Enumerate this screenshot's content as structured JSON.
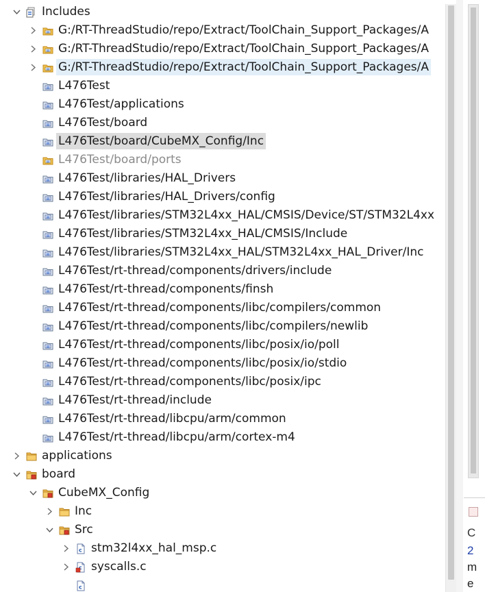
{
  "tree": [
    {
      "label": "Includes",
      "depth": 0,
      "expander": "expanded",
      "icon": "includes-icon"
    },
    {
      "label": "G:/RT-ThreadStudio/repo/Extract/ToolChain_Support_Packages/A",
      "depth": 1,
      "expander": "collapsed",
      "icon": "include-folder-icon"
    },
    {
      "label": "G:/RT-ThreadStudio/repo/Extract/ToolChain_Support_Packages/A",
      "depth": 1,
      "expander": "collapsed",
      "icon": "include-folder-icon"
    },
    {
      "label": "G:/RT-ThreadStudio/repo/Extract/ToolChain_Support_Packages/A",
      "depth": 1,
      "expander": "collapsed",
      "icon": "include-folder-icon",
      "state": "hover"
    },
    {
      "label": "L476Test",
      "depth": 1,
      "expander": "none",
      "icon": "include-path-icon"
    },
    {
      "label": "L476Test/applications",
      "depth": 1,
      "expander": "none",
      "icon": "include-path-icon"
    },
    {
      "label": "L476Test/board",
      "depth": 1,
      "expander": "none",
      "icon": "include-path-icon"
    },
    {
      "label": "L476Test/board/CubeMX_Config/Inc",
      "depth": 1,
      "expander": "none",
      "icon": "include-path-icon",
      "state": "selected"
    },
    {
      "label": "L476Test/board/ports",
      "depth": 1,
      "expander": "none",
      "icon": "include-folder-icon",
      "state": "disabled"
    },
    {
      "label": "L476Test/libraries/HAL_Drivers",
      "depth": 1,
      "expander": "none",
      "icon": "include-path-icon"
    },
    {
      "label": "L476Test/libraries/HAL_Drivers/config",
      "depth": 1,
      "expander": "none",
      "icon": "include-path-icon"
    },
    {
      "label": "L476Test/libraries/STM32L4xx_HAL/CMSIS/Device/ST/STM32L4xx",
      "depth": 1,
      "expander": "none",
      "icon": "include-path-icon"
    },
    {
      "label": "L476Test/libraries/STM32L4xx_HAL/CMSIS/Include",
      "depth": 1,
      "expander": "none",
      "icon": "include-path-icon"
    },
    {
      "label": "L476Test/libraries/STM32L4xx_HAL/STM32L4xx_HAL_Driver/Inc",
      "depth": 1,
      "expander": "none",
      "icon": "include-path-icon"
    },
    {
      "label": "L476Test/rt-thread/components/drivers/include",
      "depth": 1,
      "expander": "none",
      "icon": "include-path-icon"
    },
    {
      "label": "L476Test/rt-thread/components/finsh",
      "depth": 1,
      "expander": "none",
      "icon": "include-path-icon"
    },
    {
      "label": "L476Test/rt-thread/components/libc/compilers/common",
      "depth": 1,
      "expander": "none",
      "icon": "include-path-icon"
    },
    {
      "label": "L476Test/rt-thread/components/libc/compilers/newlib",
      "depth": 1,
      "expander": "none",
      "icon": "include-path-icon"
    },
    {
      "label": "L476Test/rt-thread/components/libc/posix/io/poll",
      "depth": 1,
      "expander": "none",
      "icon": "include-path-icon"
    },
    {
      "label": "L476Test/rt-thread/components/libc/posix/io/stdio",
      "depth": 1,
      "expander": "none",
      "icon": "include-path-icon"
    },
    {
      "label": "L476Test/rt-thread/components/libc/posix/ipc",
      "depth": 1,
      "expander": "none",
      "icon": "include-path-icon"
    },
    {
      "label": "L476Test/rt-thread/include",
      "depth": 1,
      "expander": "none",
      "icon": "include-path-icon"
    },
    {
      "label": "L476Test/rt-thread/libcpu/arm/common",
      "depth": 1,
      "expander": "none",
      "icon": "include-path-icon"
    },
    {
      "label": "L476Test/rt-thread/libcpu/arm/cortex-m4",
      "depth": 1,
      "expander": "none",
      "icon": "include-path-icon"
    },
    {
      "label": "applications",
      "depth": 0,
      "expander": "collapsed",
      "icon": "folder-icon"
    },
    {
      "label": "board",
      "depth": 0,
      "expander": "expanded",
      "icon": "source-folder-icon"
    },
    {
      "label": "CubeMX_Config",
      "depth": 1,
      "expander": "expanded",
      "icon": "source-folder-icon"
    },
    {
      "label": "Inc",
      "depth": 2,
      "expander": "collapsed",
      "icon": "folder-icon"
    },
    {
      "label": "Src",
      "depth": 2,
      "expander": "expanded",
      "icon": "source-folder-icon"
    },
    {
      "label": "stm32l4xx_hal_msp.c",
      "depth": 3,
      "expander": "collapsed",
      "icon": "c-file-icon"
    },
    {
      "label": "syscalls.c",
      "depth": 3,
      "expander": "collapsed",
      "icon": "c-file-error-icon"
    },
    {
      "label": "",
      "depth": 3,
      "expander": "none",
      "icon": "c-file-icon",
      "state": "cut-off"
    }
  ],
  "side_panel": {
    "lines": [
      {
        "text": "C",
        "color": "#333333"
      },
      {
        "text": "2",
        "color": "#1f3fa8"
      },
      {
        "text": "m",
        "color": "#222222"
      },
      {
        "text": "e",
        "color": "#222222"
      }
    ]
  }
}
